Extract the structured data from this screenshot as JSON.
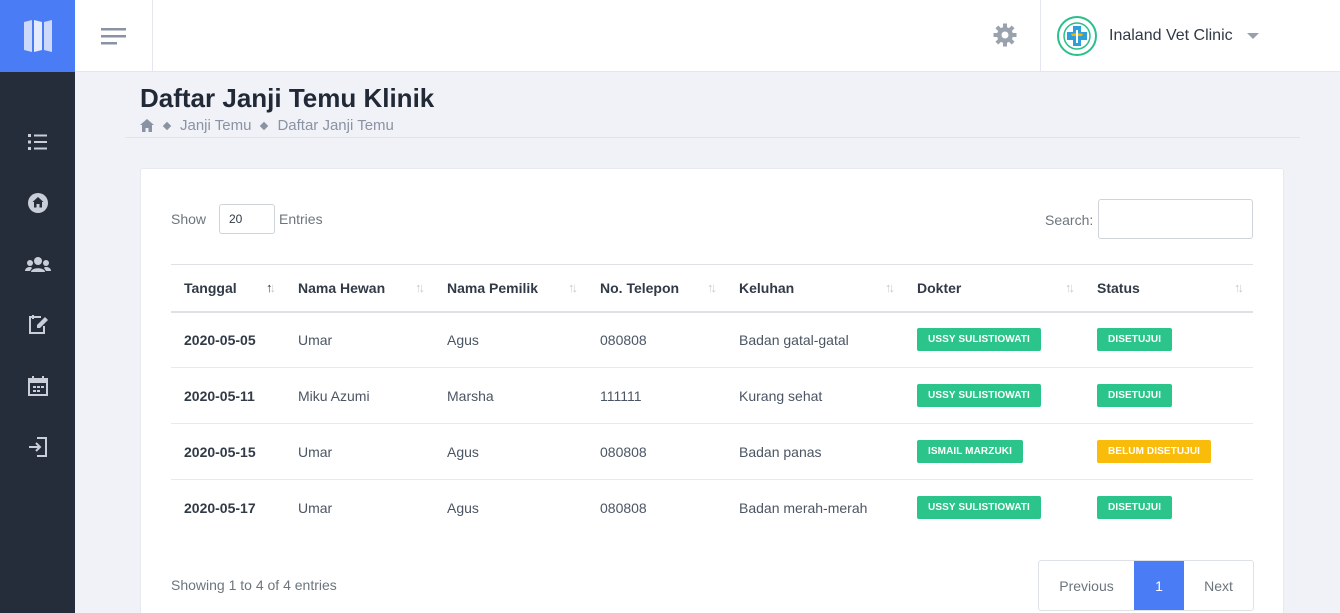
{
  "app": {
    "clinic_name": "Inaland Vet Clinic",
    "accent": "#4a7cf6",
    "sidebar_bg": "#262d3a"
  },
  "sidebar": {
    "items": [
      {
        "icon": "list-icon"
      },
      {
        "icon": "home-icon"
      },
      {
        "icon": "users-icon"
      },
      {
        "icon": "edit-calendar-icon"
      },
      {
        "icon": "calendar-icon"
      },
      {
        "icon": "sign-out-icon"
      }
    ]
  },
  "page": {
    "title": "Daftar Janji Temu Klinik",
    "breadcrumb": [
      "Janji Temu",
      "Daftar Janji Temu"
    ]
  },
  "table_controls": {
    "show_label": "Show",
    "entries_value": "20",
    "entries_label": "Entries",
    "search_label": "Search:"
  },
  "table": {
    "columns": [
      "Tanggal",
      "Nama Hewan",
      "Nama Pemilik",
      "No. Telepon",
      "Keluhan",
      "Dokter",
      "Status"
    ],
    "rows": [
      {
        "tanggal": "2020-05-05",
        "hewan": "Umar",
        "pemilik": "Agus",
        "telepon": "080808",
        "keluhan": "Badan gatal-gatal",
        "dokter": "USSY SULISTIOWATI",
        "status": "DISETUJUI",
        "status_color": "green"
      },
      {
        "tanggal": "2020-05-11",
        "hewan": "Miku Azumi",
        "pemilik": "Marsha",
        "telepon": "111111",
        "keluhan": "Kurang sehat",
        "dokter": "USSY SULISTIOWATI",
        "status": "DISETUJUI",
        "status_color": "green"
      },
      {
        "tanggal": "2020-05-15",
        "hewan": "Umar",
        "pemilik": "Agus",
        "telepon": "080808",
        "keluhan": "Badan panas",
        "dokter": "ISMAIL MARZUKI",
        "status": "BELUM DISETUJUI",
        "status_color": "yellow"
      },
      {
        "tanggal": "2020-05-17",
        "hewan": "Umar",
        "pemilik": "Agus",
        "telepon": "080808",
        "keluhan": "Badan merah-merah",
        "dokter": "USSY SULISTIOWATI",
        "status": "DISETUJUI",
        "status_color": "green"
      }
    ]
  },
  "footer": {
    "showing": "Showing 1 to 4 of 4 entries",
    "prev": "Previous",
    "current_page": "1",
    "next": "Next"
  }
}
